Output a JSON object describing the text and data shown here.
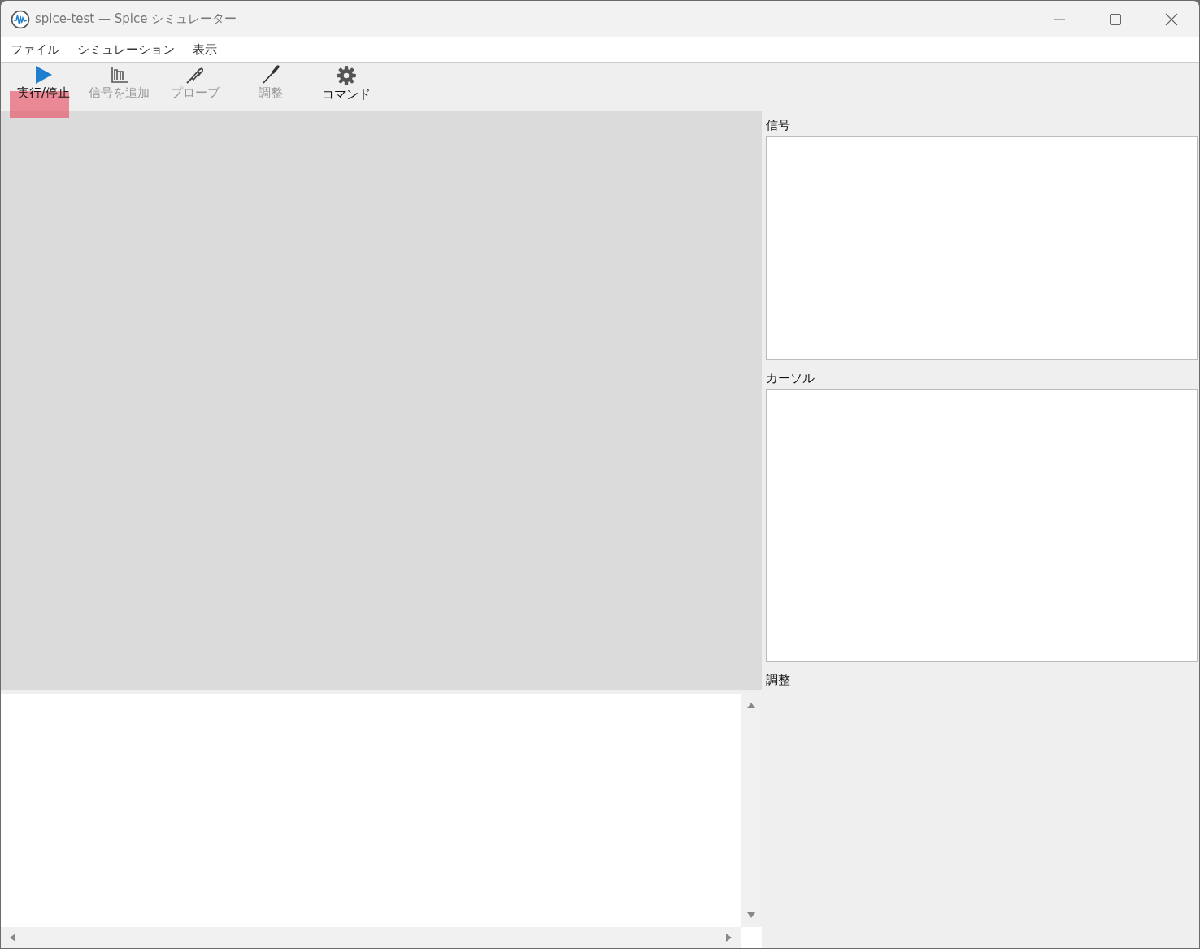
{
  "window": {
    "title": "spice-test — Spice シミュレーター"
  },
  "menu": [
    "ファイル",
    "シミュレーション",
    "表示"
  ],
  "toolbar": [
    {
      "kind": "play",
      "label": "実行/停止",
      "disabled": false,
      "highlighted": true
    },
    {
      "kind": "plot",
      "label": "信号を追加",
      "disabled": true,
      "highlighted": false
    },
    {
      "kind": "probe",
      "label": "プローブ",
      "disabled": true,
      "highlighted": false
    },
    {
      "kind": "tune",
      "label": "調整",
      "disabled": true,
      "highlighted": false
    },
    {
      "kind": "gear",
      "label": "コマンド",
      "disabled": false,
      "highlighted": false
    }
  ],
  "side_panels": [
    {
      "label": "信号",
      "kind": "list"
    },
    {
      "label": "カーソル",
      "kind": "list"
    },
    {
      "label": "調整",
      "kind": "empty"
    }
  ]
}
